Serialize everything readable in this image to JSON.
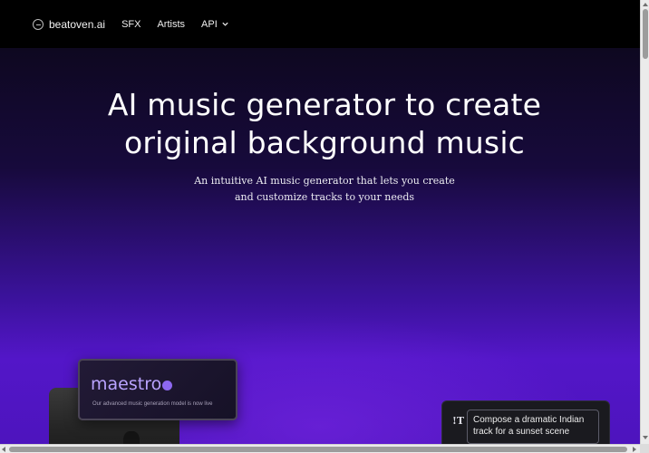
{
  "nav": {
    "logo_text": "beatoven.ai",
    "links": [
      {
        "label": "SFX"
      },
      {
        "label": "Artists"
      },
      {
        "label": "API",
        "icon": "chevron-down-icon"
      }
    ]
  },
  "hero": {
    "title_line1": "AI music generator to create",
    "title_line2": "original background music",
    "subtitle": "An intuitive AI music generator that lets you create and customize tracks to your needs"
  },
  "maestro": {
    "title": "maestro",
    "note": "Our advanced music generation model is now live"
  },
  "prompt": {
    "icon": "text-icon",
    "icon_glyph": "!T",
    "text": "Compose a dramatic Indian track for a sunset scene"
  },
  "colors": {
    "accent_purple": "#5316c8",
    "maestro_text": "#b9a3ff"
  }
}
